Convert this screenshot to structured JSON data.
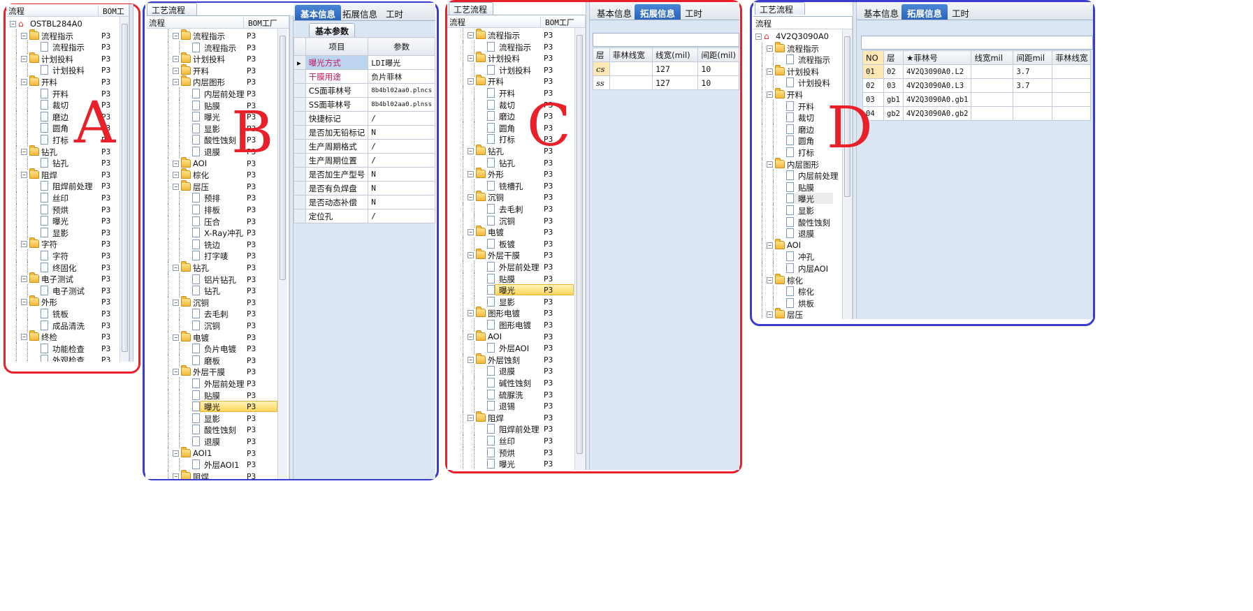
{
  "labels": {
    "a": "A",
    "b": "B",
    "c": "C",
    "d": "D"
  },
  "colors": {
    "red_frame": "#e8202a",
    "blue_frame": "#3b3bd0",
    "active_tab": "#2b64b8",
    "selected_row": "#ffd65a",
    "pink_text": "#c2185b"
  },
  "common": {
    "bom_header": "BOM工厂",
    "bom_header_short": "BOM工",
    "flow_header": "流程",
    "process_tab": "工艺流程",
    "p3": "P3"
  },
  "panelA": {
    "root": "OSTBL284A0",
    "items": [
      {
        "t": "流程指示",
        "f": 1
      },
      {
        "t": "流程指示",
        "f": 0
      },
      {
        "t": "计划投料",
        "f": 1
      },
      {
        "t": "计划投料",
        "f": 0
      },
      {
        "t": "开料",
        "f": 1
      },
      {
        "t": "开料",
        "f": 0
      },
      {
        "t": "裁切",
        "f": 0
      },
      {
        "t": "磨边",
        "f": 0
      },
      {
        "t": "圆角",
        "f": 0
      },
      {
        "t": "打标",
        "f": 0
      },
      {
        "t": "钻孔",
        "f": 1
      },
      {
        "t": "钻孔",
        "f": 0
      },
      {
        "t": "阻焊",
        "f": 1
      },
      {
        "t": "阻焊前处理",
        "f": 0
      },
      {
        "t": "丝印",
        "f": 0
      },
      {
        "t": "预烘",
        "f": 0
      },
      {
        "t": "曝光",
        "f": 0
      },
      {
        "t": "显影",
        "f": 0
      },
      {
        "t": "字符",
        "f": 1
      },
      {
        "t": "字符",
        "f": 0
      },
      {
        "t": "终固化",
        "f": 0
      },
      {
        "t": "电子测试",
        "f": 1
      },
      {
        "t": "电子测试",
        "f": 0
      },
      {
        "t": "外形",
        "f": 1
      },
      {
        "t": "铣板",
        "f": 0
      },
      {
        "t": "成品清洗",
        "f": 0
      },
      {
        "t": "终检",
        "f": 1
      },
      {
        "t": "功能检查",
        "f": 0
      },
      {
        "t": "外观检查",
        "f": 0
      }
    ]
  },
  "panelB": {
    "tabs": [
      "基本信息",
      "拓展信息",
      "工时"
    ],
    "subtab": "基本参数",
    "grid_headers": [
      "项目",
      "参数"
    ],
    "params": [
      {
        "k": "曝光方式",
        "v": "LDI曝光",
        "pink": 1
      },
      {
        "k": "干膜用途",
        "v": "负片菲林",
        "pink": 1
      },
      {
        "k": "CS面菲林号",
        "v": "8b4bl02aa0.plncs"
      },
      {
        "k": "SS面菲林号",
        "v": "8b4bl02aa0.plnss"
      },
      {
        "k": "快捷标记",
        "v": "/"
      },
      {
        "k": "是否加无铅标记",
        "v": "N"
      },
      {
        "k": "生产周期格式",
        "v": "/"
      },
      {
        "k": "生产周期位置",
        "v": "/"
      },
      {
        "k": "是否加生产型号",
        "v": "N"
      },
      {
        "k": "是否有负焊盘",
        "v": "N"
      },
      {
        "k": "是否动态补偿",
        "v": "N"
      },
      {
        "k": "定位孔",
        "v": "/"
      }
    ],
    "items": [
      {
        "t": "流程指示",
        "f": 1
      },
      {
        "t": "流程指示",
        "f": 0
      },
      {
        "t": "计划投料",
        "f": 1
      },
      {
        "t": "开料",
        "f": 1
      },
      {
        "t": "内层图形",
        "f": 1
      },
      {
        "t": "内层前处理",
        "f": 0
      },
      {
        "t": "贴膜",
        "f": 0
      },
      {
        "t": "曝光",
        "f": 0
      },
      {
        "t": "显影",
        "f": 0
      },
      {
        "t": "酸性蚀刻",
        "f": 0
      },
      {
        "t": "退膜",
        "f": 0
      },
      {
        "t": "AOI",
        "f": 1
      },
      {
        "t": "棕化",
        "f": 1
      },
      {
        "t": "层压",
        "f": 1
      },
      {
        "t": "预排",
        "f": 0
      },
      {
        "t": "排板",
        "f": 0
      },
      {
        "t": "压合",
        "f": 0
      },
      {
        "t": "X-Ray冲孔",
        "f": 0
      },
      {
        "t": "铣边",
        "f": 0
      },
      {
        "t": "打字唛",
        "f": 0
      },
      {
        "t": "钻孔",
        "f": 1
      },
      {
        "t": "铝片钻孔",
        "f": 0
      },
      {
        "t": "钻孔",
        "f": 0
      },
      {
        "t": "沉铜",
        "f": 1
      },
      {
        "t": "去毛刺",
        "f": 0
      },
      {
        "t": "沉铜",
        "f": 0
      },
      {
        "t": "电镀",
        "f": 1
      },
      {
        "t": "负片电镀",
        "f": 0
      },
      {
        "t": "磨板",
        "f": 0
      },
      {
        "t": "外层干膜",
        "f": 1
      },
      {
        "t": "外层前处理",
        "f": 0
      },
      {
        "t": "贴膜",
        "f": 0
      },
      {
        "t": "曝光",
        "f": 0,
        "sel": 1
      },
      {
        "t": "显影",
        "f": 0
      },
      {
        "t": "酸性蚀刻",
        "f": 0
      },
      {
        "t": "退膜",
        "f": 0
      },
      {
        "t": "AOI1",
        "f": 1
      },
      {
        "t": "外层AOI1",
        "f": 0
      },
      {
        "t": "阻焊",
        "f": 1
      }
    ]
  },
  "panelC": {
    "tabs": [
      "基本信息",
      "拓展信息",
      "工时"
    ],
    "grid_headers": [
      "层",
      "菲林线宽",
      "线宽(mil)",
      "间距(mil)"
    ],
    "rows": [
      [
        "cs",
        "",
        "127",
        "10"
      ],
      [
        "ss",
        "",
        "127",
        "10"
      ]
    ],
    "items": [
      {
        "t": "流程指示",
        "f": 1
      },
      {
        "t": "流程指示",
        "f": 0
      },
      {
        "t": "计划投料",
        "f": 1
      },
      {
        "t": "计划投料",
        "f": 0
      },
      {
        "t": "开料",
        "f": 1
      },
      {
        "t": "开料",
        "f": 0
      },
      {
        "t": "裁切",
        "f": 0
      },
      {
        "t": "磨边",
        "f": 0
      },
      {
        "t": "圆角",
        "f": 0
      },
      {
        "t": "打标",
        "f": 0
      },
      {
        "t": "钻孔",
        "f": 1
      },
      {
        "t": "钻孔",
        "f": 0
      },
      {
        "t": "外形",
        "f": 1
      },
      {
        "t": "铣槽孔",
        "f": 0
      },
      {
        "t": "沉铜",
        "f": 1
      },
      {
        "t": "去毛刺",
        "f": 0
      },
      {
        "t": "沉铜",
        "f": 0
      },
      {
        "t": "电镀",
        "f": 1
      },
      {
        "t": "板镀",
        "f": 0
      },
      {
        "t": "外层干膜",
        "f": 1
      },
      {
        "t": "外层前处理",
        "f": 0
      },
      {
        "t": "贴膜",
        "f": 0
      },
      {
        "t": "曝光",
        "f": 0,
        "sel": 1
      },
      {
        "t": "显影",
        "f": 0
      },
      {
        "t": "图形电镀",
        "f": 1
      },
      {
        "t": "图形电镀",
        "f": 0
      },
      {
        "t": "AOI",
        "f": 1
      },
      {
        "t": "外层AOI",
        "f": 0
      },
      {
        "t": "外层蚀刻",
        "f": 1
      },
      {
        "t": "退膜",
        "f": 0
      },
      {
        "t": "碱性蚀刻",
        "f": 0
      },
      {
        "t": "硫脲洗",
        "f": 0
      },
      {
        "t": "退锡",
        "f": 0
      },
      {
        "t": "阻焊",
        "f": 1
      },
      {
        "t": "阻焊前处理",
        "f": 0
      },
      {
        "t": "丝印",
        "f": 0
      },
      {
        "t": "预烘",
        "f": 0
      },
      {
        "t": "曝光",
        "f": 0
      }
    ]
  },
  "panelD": {
    "tabs": [
      "基本信息",
      "拓展信息",
      "工时"
    ],
    "root": "4V2Q3090A0",
    "grid_headers": [
      "NO",
      "层",
      "★菲林号",
      "线宽mil",
      "间距mil",
      "菲林线宽"
    ],
    "rows": [
      [
        "01",
        "02",
        "4V2Q3090A0.L2",
        "",
        "3.7",
        ""
      ],
      [
        "02",
        "03",
        "4V2Q3090A0.L3",
        "",
        "3.7",
        ""
      ],
      [
        "03",
        "gb1",
        "4V2Q3090A0.gb1",
        "",
        "",
        ""
      ],
      [
        "04",
        "gb2",
        "4V2Q3090A0.gb2",
        "",
        "",
        ""
      ]
    ],
    "items": [
      {
        "t": "流程指示",
        "f": 1
      },
      {
        "t": "流程指示",
        "f": 0
      },
      {
        "t": "计划投料",
        "f": 1
      },
      {
        "t": "计划投料",
        "f": 0
      },
      {
        "t": "开料",
        "f": 1
      },
      {
        "t": "开料",
        "f": 0
      },
      {
        "t": "裁切",
        "f": 0
      },
      {
        "t": "磨边",
        "f": 0
      },
      {
        "t": "圆角",
        "f": 0
      },
      {
        "t": "打标",
        "f": 0
      },
      {
        "t": "内层图形",
        "f": 1
      },
      {
        "t": "内层前处理",
        "f": 0
      },
      {
        "t": "贴膜",
        "f": 0
      },
      {
        "t": "曝光",
        "f": 0,
        "hl": 1
      },
      {
        "t": "显影",
        "f": 0
      },
      {
        "t": "酸性蚀刻",
        "f": 0
      },
      {
        "t": "退膜",
        "f": 0
      },
      {
        "t": "AOI",
        "f": 1
      },
      {
        "t": "冲孔",
        "f": 0
      },
      {
        "t": "内层AOI",
        "f": 0
      },
      {
        "t": "棕化",
        "f": 1
      },
      {
        "t": "棕化",
        "f": 0
      },
      {
        "t": "烘板",
        "f": 0
      },
      {
        "t": "层压",
        "f": 1
      }
    ]
  }
}
